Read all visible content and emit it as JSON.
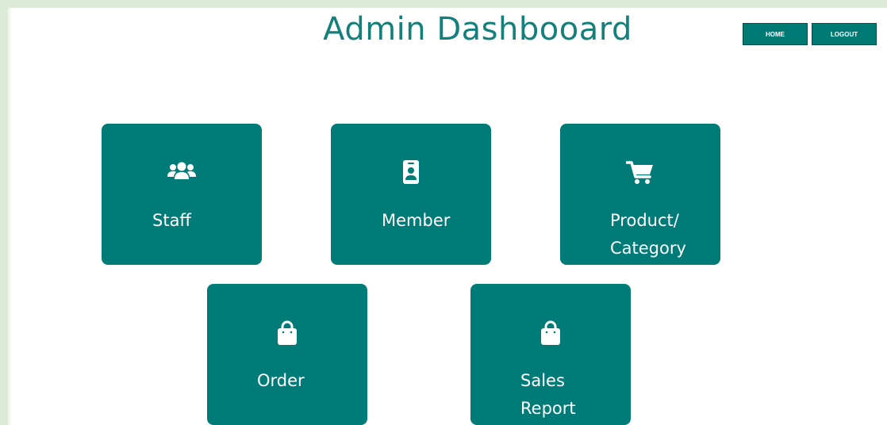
{
  "header": {
    "title": "Admin Dashbooard",
    "home_label": "HOME",
    "logout_label": "LOGOUT"
  },
  "tiles": [
    {
      "label": "Staff",
      "icon": "users-icon"
    },
    {
      "label": "Member",
      "icon": "id-badge-icon"
    },
    {
      "label": "Product/\nCategory",
      "icon": "shopping-cart-icon"
    },
    {
      "label": "Order",
      "icon": "shopping-bag-icon"
    },
    {
      "label": "Sales\nReport",
      "icon": "shopping-bag-icon"
    }
  ],
  "colors": {
    "primary": "#007b78",
    "title": "#0c7b78",
    "frame": "#dcebd6",
    "background": "#ffffff"
  }
}
